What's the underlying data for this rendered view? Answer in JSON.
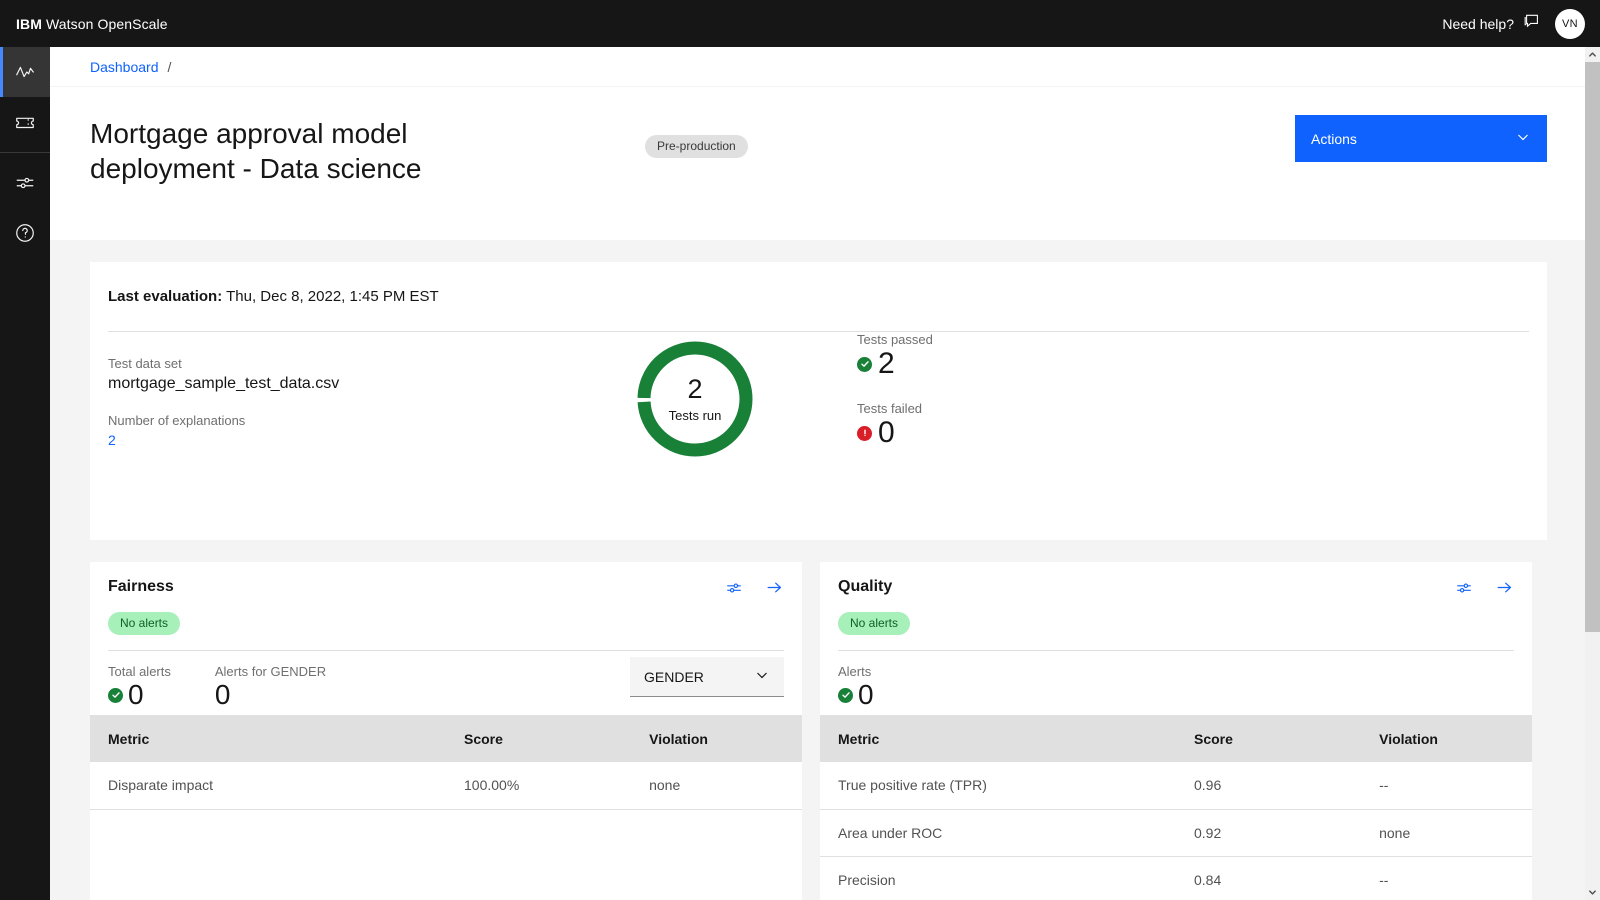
{
  "header": {
    "brand_bold": "IBM",
    "brand_rest": " Watson OpenScale",
    "need_help": "Need help?",
    "avatar_initials": "VN"
  },
  "sidebar": {
    "items": [
      {
        "name": "monitoring",
        "icon": "pulse-icon",
        "active": true
      },
      {
        "name": "tickets",
        "icon": "ticket-icon",
        "active": false
      },
      {
        "name": "configuration",
        "icon": "sliders-icon",
        "active": false
      },
      {
        "name": "help",
        "icon": "question-circle-icon",
        "active": false
      }
    ]
  },
  "breadcrumb": {
    "root": "Dashboard",
    "separator": "/"
  },
  "page": {
    "title": "Mortgage approval model deployment - Data science",
    "tag": "Pre-production",
    "actions_label": "Actions"
  },
  "summary": {
    "last_evaluation_label": "Last evaluation:",
    "last_evaluation_value": "Thu, Dec 8, 2022, 1:45 PM EST",
    "test_data_set_label": "Test data set",
    "test_data_set_value": "mortgage_sample_test_data.csv",
    "explanations_label": "Number of explanations",
    "explanations_value": "2",
    "donut_value": "2",
    "donut_caption": "Tests run",
    "tests_passed_label": "Tests passed",
    "tests_passed_value": "2",
    "tests_failed_label": "Tests failed",
    "tests_failed_value": "0"
  },
  "fairness": {
    "title": "Fairness",
    "alert_pill": "No alerts",
    "total_alerts_label": "Total alerts",
    "total_alerts_value": "0",
    "attribute_alerts_label": "Alerts for GENDER",
    "attribute_alerts_value": "0",
    "select_value": "GENDER",
    "columns": [
      "Metric",
      "Score",
      "Violation"
    ],
    "rows": [
      {
        "metric": "Disparate impact",
        "score": "100.00%",
        "violation": "none"
      }
    ]
  },
  "quality": {
    "title": "Quality",
    "alert_pill": "No alerts",
    "alerts_label": "Alerts",
    "alerts_value": "0",
    "columns": [
      "Metric",
      "Score",
      "Violation"
    ],
    "rows": [
      {
        "metric": "True positive rate (TPR)",
        "score": "0.96",
        "violation": "--"
      },
      {
        "metric": "Area under ROC",
        "score": "0.92",
        "violation": "none"
      },
      {
        "metric": "Precision",
        "score": "0.84",
        "violation": "--"
      }
    ]
  },
  "colors": {
    "accent_blue": "#0f62fe",
    "link_blue": "#0f62fe",
    "success_green": "#198038",
    "donut_green": "#198038",
    "error_red": "#da1e28",
    "pill_green_bg": "#a7f0ba",
    "header_black": "#161616"
  }
}
